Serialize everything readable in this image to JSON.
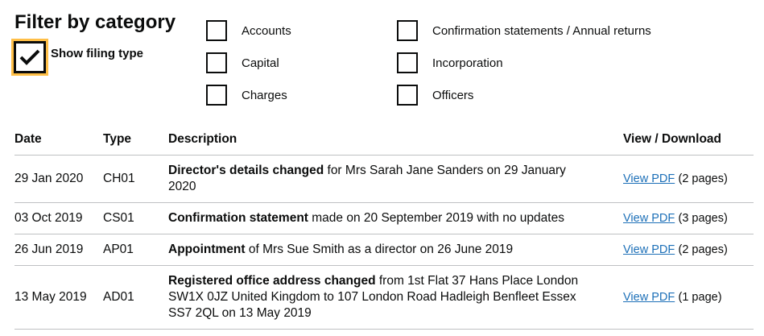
{
  "filter": {
    "heading": "Filter by category",
    "show_filing_type": {
      "label": "Show filing type",
      "checked": true
    },
    "categories": [
      {
        "label": "Accounts"
      },
      {
        "label": "Confirmation statements / Annual returns"
      },
      {
        "label": "Capital"
      },
      {
        "label": "Incorporation"
      },
      {
        "label": "Charges"
      },
      {
        "label": "Officers"
      }
    ]
  },
  "table": {
    "headers": {
      "date": "Date",
      "type": "Type",
      "description": "Description",
      "view": "View / Download"
    },
    "rows": [
      {
        "date": "29 Jan 2020",
        "type": "CH01",
        "desc_bold": "Director's details changed",
        "desc_rest": " for Mrs Sarah Jane Sanders on 29 January 2020",
        "link": "View PDF",
        "pages": "(2 pages)"
      },
      {
        "date": "03 Oct 2019",
        "type": "CS01",
        "desc_bold": "Confirmation statement",
        "desc_rest": " made on 20 September 2019 with no updates",
        "link": "View PDF",
        "pages": "(3 pages)"
      },
      {
        "date": "26 Jun 2019",
        "type": "AP01",
        "desc_bold": "Appointment",
        "desc_rest": " of Mrs Sue Smith as a director on 26 June 2019",
        "link": "View PDF",
        "pages": "(2 pages)"
      },
      {
        "date": "13 May 2019",
        "type": "AD01",
        "desc_bold": "Registered office address changed",
        "desc_rest": " from 1st Flat 37 Hans Place London SW1X 0JZ United Kingdom to 107 London Road Hadleigh Benfleet Essex SS7 2QL on 13 May 2019",
        "link": "View PDF",
        "pages": "(1 page)"
      }
    ]
  },
  "colors": {
    "link": "#1d70b8",
    "focus": "#ffbf47",
    "text": "#0b0c0c"
  }
}
